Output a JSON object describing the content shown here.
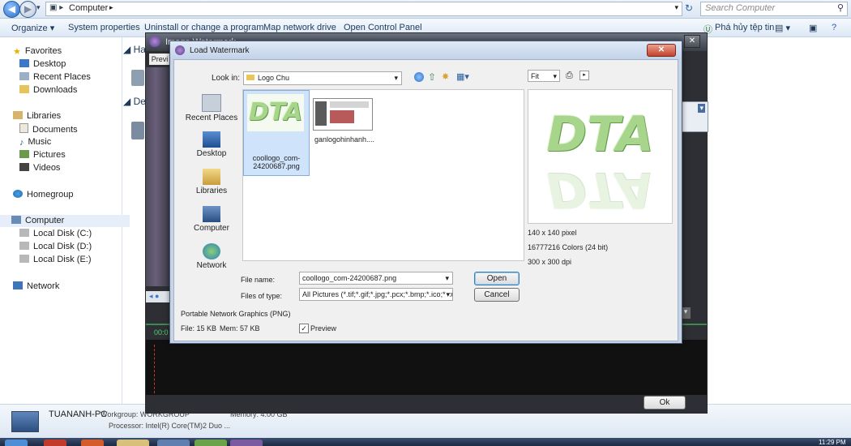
{
  "explorer": {
    "address": "Computer",
    "search_placeholder": "Search Computer",
    "toolbar": [
      "Organize ▾",
      "System properties",
      "Uninstall or change a program",
      "Map network drive",
      "Open Control Panel"
    ],
    "toolbar_right": "Phá hủy tệp tin",
    "nav": {
      "favorites": "Favorites",
      "desktop": "Desktop",
      "recent": "Recent Places",
      "downloads": "Downloads",
      "libraries": "Libraries",
      "documents": "Documents",
      "music": "Music",
      "pictures": "Pictures",
      "videos": "Videos",
      "homegroup": "Homegroup",
      "computer": "Computer",
      "disk_c": "Local Disk (C:)",
      "disk_d": "Local Disk (D:)",
      "disk_e": "Local Disk (E:)",
      "network": "Network"
    },
    "section_a": "Ha",
    "section_b": "De",
    "details": {
      "pc_name": "TUANANH-PC",
      "workgroup": "Workgroup: WORKGROUP",
      "memory": "Memory: 4.00 GB",
      "processor": "Processor: Intel(R) Core(TM)2 Duo ..."
    },
    "clock": "11:29 PM"
  },
  "watermark_window": {
    "title": "Image Watermark",
    "preview_label": "Previ",
    "time_left": "00:0",
    "ok_label": "Ok"
  },
  "load_dialog": {
    "title": "Load Watermark",
    "look_in_label": "Look in:",
    "look_in_value": "Logo Chu",
    "places": [
      "Recent Places",
      "Desktop",
      "Libraries",
      "Computer",
      "Network"
    ],
    "files": [
      {
        "name": "coollogo_com-24200687.png",
        "selected": true
      },
      {
        "name": "ganlogohinhanh...."
      }
    ],
    "file_name_label": "File name:",
    "file_name_value": "coollogo_com-24200687.png",
    "file_type_label": "Files of type:",
    "file_type_value": "All Pictures (*.tif;*.gif;*.jpg;*.pcx;*.bmp;*.ico;*.cu",
    "open_label": "Open",
    "cancel_label": "Cancel",
    "format": "Portable Network Graphics (PNG)",
    "file_size": "File: 15 KB",
    "mem": "Mem: 57 KB",
    "preview_check_label": "Preview",
    "preview_checked": true,
    "fit_option": "Fit",
    "logo_text": "DTA",
    "info": {
      "dimensions": "140 x 140 pixel",
      "colors": "16777216 Colors (24 bit)",
      "dpi": "300 x 300 dpi"
    }
  }
}
